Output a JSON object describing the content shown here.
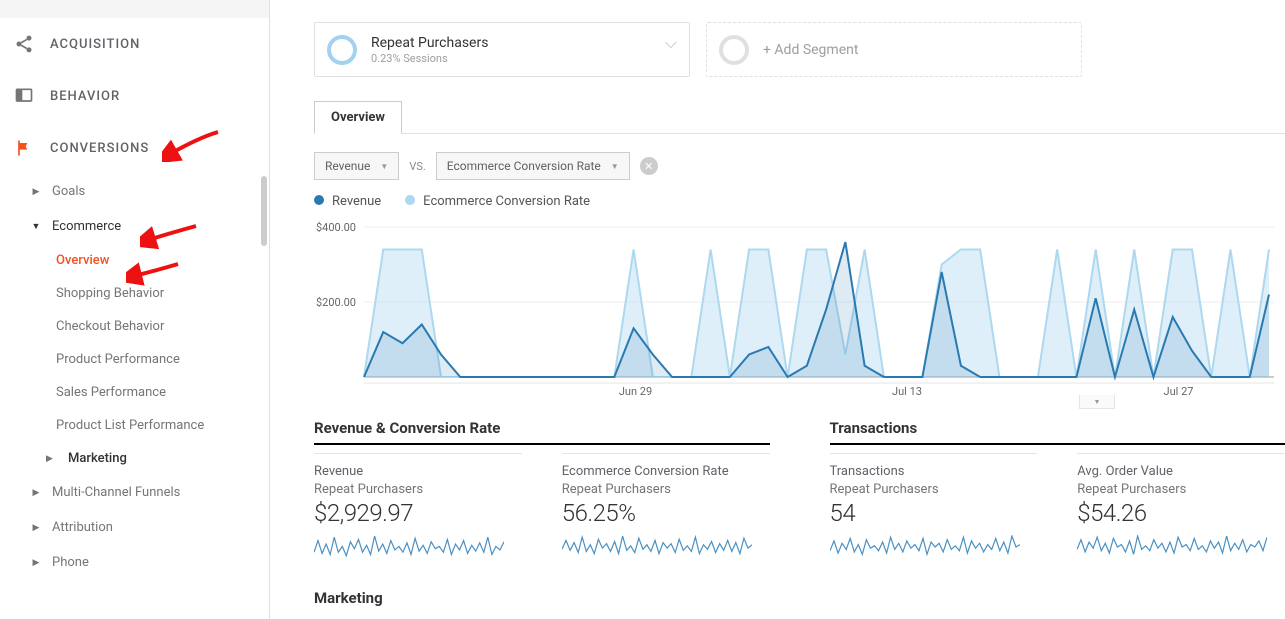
{
  "sidebar": {
    "sections": {
      "acquisition": "ACQUISITION",
      "behavior": "BEHAVIOR",
      "conversions": "CONVERSIONS"
    },
    "conversions_items": [
      {
        "label": "Goals",
        "expanded": false
      },
      {
        "label": "Ecommerce",
        "expanded": true
      },
      {
        "label": "Multi-Channel Funnels",
        "expanded": false
      },
      {
        "label": "Attribution",
        "expanded": false
      },
      {
        "label": "Phone",
        "expanded": false
      }
    ],
    "ecommerce_sub": [
      "Overview",
      "Shopping Behavior",
      "Checkout Behavior",
      "Product Performance",
      "Sales Performance",
      "Product List Performance",
      "Marketing"
    ]
  },
  "segments": {
    "selected": {
      "title": "Repeat Purchasers",
      "subtitle": "0.23% Sessions"
    },
    "add_label": "+ Add Segment"
  },
  "tabs": {
    "overview": "Overview"
  },
  "controls": {
    "metric1": "Revenue",
    "vs": "VS.",
    "metric2": "Ecommerce Conversion Rate"
  },
  "legend": {
    "series1": "Revenue",
    "series2": "Ecommerce Conversion Rate"
  },
  "chart_data": {
    "type": "line",
    "ylabel": "",
    "xlabel": "",
    "ylim": [
      0,
      400
    ],
    "yticks": [
      "$200.00",
      "$400.00"
    ],
    "xticks": [
      "Jun 29",
      "Jul 13",
      "Jul 27"
    ],
    "series": [
      {
        "name": "Revenue",
        "color": "#2a7ab0",
        "values": [
          0,
          120,
          90,
          140,
          60,
          0,
          0,
          0,
          0,
          0,
          0,
          0,
          0,
          0,
          130,
          60,
          0,
          0,
          0,
          0,
          60,
          80,
          0,
          30,
          180,
          360,
          30,
          0,
          0,
          0,
          280,
          30,
          0,
          0,
          0,
          0,
          0,
          0,
          210,
          0,
          180,
          0,
          160,
          70,
          0,
          0,
          0,
          220
        ]
      },
      {
        "name": "Ecommerce Conversion Rate",
        "color": "#add8ef",
        "values": [
          0,
          340,
          340,
          340,
          0,
          0,
          0,
          0,
          0,
          0,
          0,
          0,
          0,
          0,
          340,
          0,
          0,
          0,
          340,
          0,
          340,
          340,
          0,
          340,
          340,
          60,
          340,
          0,
          0,
          0,
          300,
          340,
          340,
          0,
          0,
          0,
          340,
          0,
          340,
          0,
          340,
          0,
          340,
          340,
          0,
          340,
          0,
          340
        ]
      }
    ],
    "sparklines": {
      "revenue": [
        5,
        15,
        4,
        12,
        3,
        18,
        5,
        10,
        2,
        14,
        8,
        16,
        5,
        11,
        3,
        19,
        6,
        12,
        4,
        15,
        7,
        10,
        5,
        13,
        3,
        17,
        6,
        11,
        4,
        14,
        8,
        10,
        5,
        16,
        3,
        12,
        7,
        15,
        4,
        11,
        6,
        13,
        5,
        18,
        3,
        10,
        7,
        14
      ],
      "ecr": [
        8,
        16,
        7,
        14,
        5,
        19,
        6,
        12,
        4,
        17,
        9,
        13,
        6,
        15,
        4,
        20,
        7,
        11,
        5,
        18,
        8,
        12,
        6,
        16,
        4,
        14,
        9,
        13,
        5,
        17,
        7,
        11,
        6,
        19,
        4,
        12,
        8,
        15,
        5,
        13,
        7,
        16,
        6,
        14,
        4,
        18,
        9,
        12
      ],
      "transactions": [
        6,
        14,
        4,
        12,
        7,
        16,
        5,
        11,
        3,
        15,
        8,
        10,
        6,
        13,
        4,
        17,
        7,
        12,
        5,
        14,
        8,
        11,
        6,
        16,
        3,
        13,
        9,
        12,
        5,
        15,
        7,
        10,
        6,
        17,
        4,
        14,
        8,
        12,
        5,
        11,
        7,
        16,
        6,
        13,
        4,
        18,
        9,
        11
      ],
      "aov": [
        7,
        15,
        5,
        13,
        8,
        17,
        6,
        12,
        4,
        16,
        9,
        11,
        5,
        14,
        3,
        18,
        7,
        10,
        6,
        15,
        8,
        12,
        5,
        13,
        4,
        17,
        9,
        11,
        6,
        16,
        7,
        10,
        5,
        14,
        8,
        13,
        4,
        18,
        6,
        12,
        7,
        15,
        5,
        11,
        9,
        14,
        6,
        17
      ]
    }
  },
  "metric_groups": [
    {
      "title": "Revenue & Conversion Rate",
      "cards": [
        {
          "label": "Revenue",
          "segment": "Repeat Purchasers",
          "value": "$2,929.97",
          "spark": "revenue"
        },
        {
          "label": "Ecommerce Conversion Rate",
          "segment": "Repeat Purchasers",
          "value": "56.25%",
          "spark": "ecr"
        }
      ]
    },
    {
      "title": "Transactions",
      "cards": [
        {
          "label": "Transactions",
          "segment": "Repeat Purchasers",
          "value": "54",
          "spark": "transactions"
        },
        {
          "label": "Avg. Order Value",
          "segment": "Repeat Purchasers",
          "value": "$54.26",
          "spark": "aov"
        }
      ]
    }
  ],
  "marketing_title": "Marketing"
}
